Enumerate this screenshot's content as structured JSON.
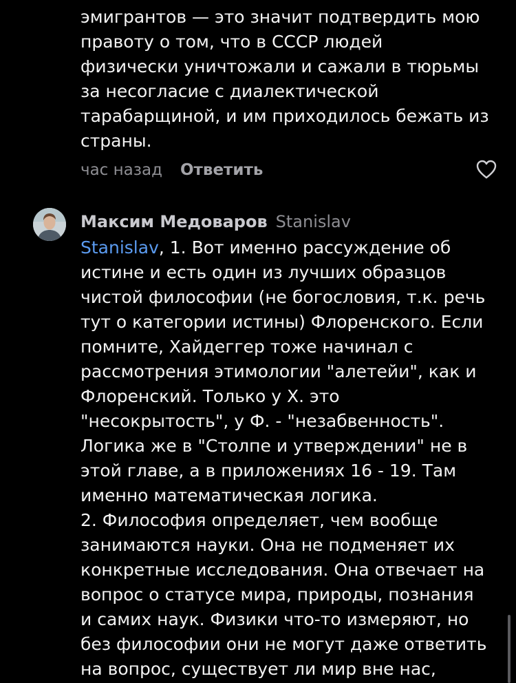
{
  "comment1": {
    "lines": [
      "эмигрантов — это значит подтвердить мою",
      "правоту о том, что в СССР людей",
      "физически уничтожали и сажали в тюрьмы",
      "за несогласие с диалектической",
      "тарабарщиной, и им приходилось бежать из",
      "страны."
    ],
    "time": "час назад",
    "reply_label": "Ответить",
    "like_icon": "heart-outline-icon"
  },
  "comment2": {
    "author": "Максим Медоваров",
    "reply_to": "Stanislav",
    "mention": "Stanislav",
    "first_line_rest": ", 1. Вот именно рассуждение об",
    "lines": [
      "истине и есть один из лучших образцов",
      "чистой философии (не богословия, т.к. речь",
      "тут о категории истины) Флоренского. Если",
      "помните, Хайдеггер тоже начинал с",
      "рассмотрения этимологии \"алетейи\", как и",
      "Флоренский. Только у Х. это",
      "\"несокрытость\", у Ф. - \"незабвенность\".",
      "Логика же в \"Столпе и утверждении\" не в",
      "этой главе, а в приложениях 16 - 19. Там",
      "именно математическая логика.",
      "2. Философия определяет, чем вообще",
      "занимаются науки. Она не подменяет их",
      "конкретные исследования. Она отвечает на",
      "вопрос о статусе мира, природы, познания",
      "и самих наук. Физики что-то измеряют, но",
      "без философии они не могут даже ответить",
      "на вопрос, существует ли мир вне нас,"
    ],
    "mention_color": "#5b9bf0"
  }
}
